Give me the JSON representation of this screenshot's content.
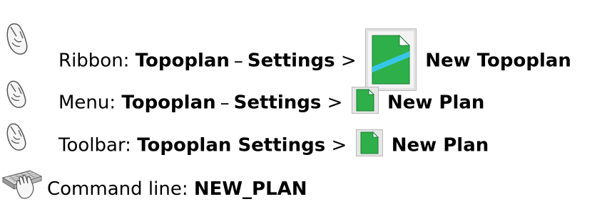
{
  "rows": [
    {
      "label": "Ribbon:",
      "path_1": "Topoplan",
      "dash": "–",
      "path_2": "Settings",
      "arrow": ">",
      "command": "New Topoplan",
      "icon": "mouse-icon",
      "button_icon": "new-topoplan-icon"
    },
    {
      "label": "Menu:",
      "path_1": "Topoplan",
      "dash": "–",
      "path_2": "Settings",
      "arrow": ">",
      "command": "New Plan",
      "icon": "mouse-icon",
      "button_icon": "new-plan-icon"
    },
    {
      "label": "Toolbar:",
      "path_1": "Topoplan Settings",
      "arrow": ">",
      "command": "New Plan",
      "icon": "mouse-icon",
      "button_icon": "new-plan-icon"
    },
    {
      "label": "Command line:",
      "command": "NEW_PLAN",
      "icon": "keyboard-icon"
    }
  ],
  "colors": {
    "icon_green": "#2eaf4a",
    "icon_blue": "#38c6e8",
    "button_frame": "#b8b8b8"
  }
}
